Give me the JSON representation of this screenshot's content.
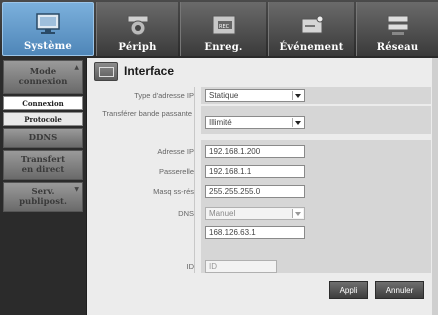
{
  "tabs": [
    {
      "label": "Système",
      "icon": "monitor-icon"
    },
    {
      "label": "Périph",
      "icon": "camera-icon"
    },
    {
      "label": "Enreg.",
      "icon": "record-icon"
    },
    {
      "label": "Événement",
      "icon": "event-icon"
    },
    {
      "label": "Réseau",
      "icon": "network-icon"
    }
  ],
  "sidebar": {
    "items": [
      {
        "label": "Mode\nconnexion",
        "type": "group"
      },
      {
        "label": "Connexion",
        "type": "sub"
      },
      {
        "label": "Protocole",
        "type": "sub"
      },
      {
        "label": "DDNS",
        "type": "group"
      },
      {
        "label": "Transfert\nen direct",
        "type": "group"
      },
      {
        "label": "Serv.\npublipost.",
        "type": "group"
      }
    ]
  },
  "panel": {
    "title": "Interface",
    "ip_type_label": "Type d'adresse IP",
    "ip_type_value": "Statique",
    "bandwidth_label": "Transférer bande passante",
    "bandwidth_value": "Illimité",
    "ip_label": "Adresse IP",
    "ip_value": "192.168.1.200",
    "gateway_label": "Passerelle",
    "gateway_value": "192.168.1.1",
    "mask_label": "Masq ss-rés",
    "mask_value": "255.255.255.0",
    "dns_label": "DNS",
    "dns_mode_value": "Manuel",
    "dns_value": "168.126.63.1",
    "id_label": "ID",
    "id_placeholder": "ID",
    "apply_label": "Appli",
    "cancel_label": "Annuler"
  },
  "colors": {
    "active_tab": "#5d94c6",
    "panel_bg": "#ececec",
    "row_bg": "#d6d6d6"
  }
}
